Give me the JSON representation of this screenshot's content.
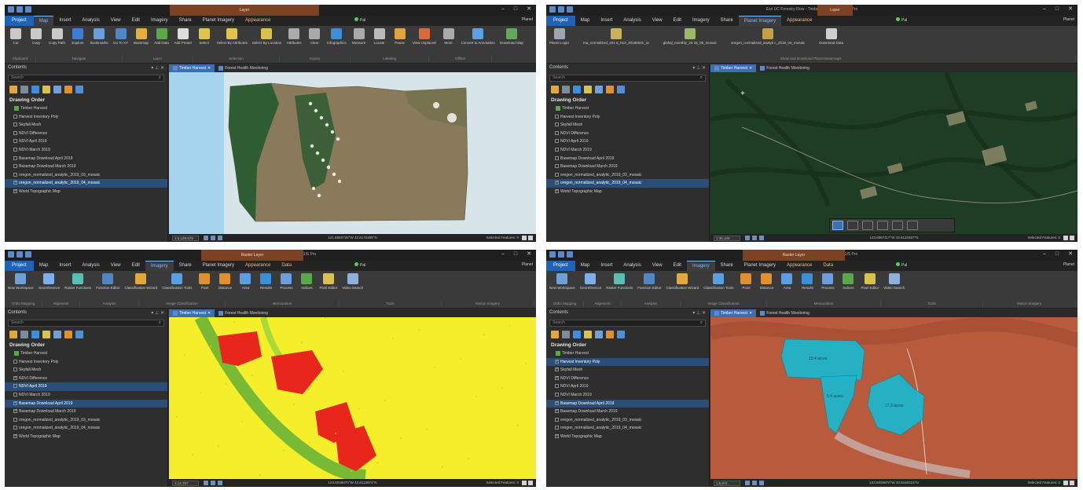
{
  "panels": [
    {
      "id": "p1",
      "window_title": "Esri UC Forestry Flow - Timber Harvest - ArcGIS Pro",
      "contextual_tab_group": "Layer",
      "tabs": [
        "Project",
        "Map",
        "Insert",
        "Analysis",
        "View",
        "Edit",
        "Imagery",
        "Share",
        "Planet Imagery",
        "Appearance"
      ],
      "active_tab": "Map",
      "user": "Pal",
      "user_right": "Planet",
      "ribbon_buttons": [
        "Cut",
        "Copy",
        "Copy Path",
        "Explore",
        "Bookmarks",
        "Go To XY",
        "Basemap",
        "Add Data",
        "Add Preset",
        "Select",
        "Select By Attributes",
        "Select By Location",
        "Attributes",
        "Clear",
        "Infographics",
        "Measure",
        "Locate",
        "Pause",
        "View Unplaced",
        "More",
        "Convert to Annotation",
        "Download Map"
      ],
      "ribbon_groups": [
        "Clipboard",
        "Navigate",
        "Layer",
        "Selection",
        "Inquiry",
        "Labeling",
        "Offline"
      ],
      "map_tabs": [
        "Timber Harvest",
        "Forest Health Monitoring"
      ],
      "scale": "1:6,129,879",
      "coordinates": "121.6865729°W 43.6172485°N",
      "selected_features": "Selected Features: 0"
    },
    {
      "id": "p2",
      "window_title": "Esri UC Forestry Flow - Timber Harvest - ArcGIS Pro",
      "contextual_tab_group": "Layer",
      "tabs": [
        "Project",
        "Map",
        "Insert",
        "Analysis",
        "View",
        "Edit",
        "Imagery",
        "Share",
        "Planet Imagery",
        "Appearance"
      ],
      "active_tab": "Planet Imagery",
      "user": "Pal",
      "user_right": "Planet",
      "ribbon_buttons": [
        "Planet Login",
        "ma_normalized_201 8_013_20180531_ra",
        "global_monthly_20 18_05_mosaic",
        "oregon_normalized_analyti c_2019_04_mosaic",
        "Download Data"
      ],
      "ribbon_groups": [
        "Show and Download Planet Basemaps"
      ],
      "map_tabs": [
        "Timber Harvest",
        "Forest Health Monitoring"
      ],
      "scale": "1:36,109",
      "coordinates": "123.8067117°W 43.6134467°N",
      "selected_features": "Selected Features: 0"
    },
    {
      "id": "p3",
      "window_title": "Esri UC Forestry Flow - Timber Harvest - ArcGIS Pro",
      "contextual_tab_group": "Raster Layer",
      "tabs": [
        "Project",
        "Map",
        "Insert",
        "Analysis",
        "View",
        "Edit",
        "Imagery",
        "Share",
        "Planet Imagery",
        "Appearance",
        "Data"
      ],
      "active_tab": "Imagery",
      "user": "Pal",
      "user_right": "Planet",
      "ribbon_buttons": [
        "New Workspace",
        "Georeference",
        "Raster Functions",
        "Function Editor",
        "Classification Wizard",
        "Classification Tools",
        "Pixel",
        "Distance",
        "Area",
        "Results",
        "Process",
        "Indices",
        "Pixel Editor",
        "Video Search"
      ],
      "ribbon_groups": [
        "Ortho Mapping",
        "Alignment",
        "Analysis",
        "Image Classification",
        "Mensuration",
        "Tools",
        "Motion Imagery"
      ],
      "map_tabs": [
        "Timber Harvest",
        "Forest Health Monitoring"
      ],
      "scale": "1:14,757",
      "coordinates": "123.6036870°W 43.6112974°N",
      "selected_features": "Selected Features: 0"
    },
    {
      "id": "p4",
      "window_title": "Esri UC Forestry Flow - Timber Harvest - ArcGIS Pro",
      "contextual_tab_group": "Raster Layer",
      "tabs": [
        "Project",
        "Map",
        "Insert",
        "Analysis",
        "View",
        "Edit",
        "Imagery",
        "Share",
        "Planet Imagery",
        "Appearance",
        "Data"
      ],
      "active_tab": "Imagery",
      "user": "Pal",
      "user_right": "Planet",
      "ribbon_buttons": [
        "New Workspace",
        "Georeference",
        "Raster Functions",
        "Function Editor",
        "Classification Wizard",
        "Classification Tools",
        "Point",
        "Distance",
        "Area",
        "Results",
        "Process",
        "Indices",
        "Pixel Editor",
        "Video Search"
      ],
      "ribbon_groups": [
        "Ortho Mapping",
        "Alignment",
        "Analysis",
        "Image Classification",
        "Mensuration",
        "Tools",
        "Motion Imagery"
      ],
      "map_tabs": [
        "Timber Harvest",
        "Forest Health Monitoring"
      ],
      "scale": "1:5,671",
      "coordinates": "123.6036870°W 43.6150313°N",
      "selected_features": "Selected Features: 0",
      "harvest_units": [
        "15.4 acres",
        "5.4 acres",
        "17.3 acres"
      ]
    }
  ],
  "contents": {
    "title": "Contents",
    "search_placeholder": "Search",
    "drawing_order": "Drawing Order",
    "map_name": "Timber Harvest",
    "layers": [
      "Harvest Inventory Poly",
      "Skyfall Mesh",
      "NDVI Difference",
      "NDVI April 2019",
      "NDVI March 2019",
      "Basemap Download April 2019",
      "Basemap Download March 2019",
      "oregon_normalized_analytic_2019_03_mosaic",
      "oregon_normalized_analytic_2019_04_mosaic",
      "World Topographic Map"
    ]
  },
  "panel_states": {
    "p1": {
      "checked": [
        false,
        false,
        false,
        false,
        false,
        false,
        false,
        false,
        true,
        true
      ],
      "selected": [
        8
      ]
    },
    "p2": {
      "checked": [
        false,
        false,
        false,
        false,
        false,
        false,
        false,
        false,
        true,
        true
      ],
      "selected": [
        8
      ]
    },
    "p3": {
      "checked": [
        false,
        false,
        true,
        false,
        false,
        true,
        true,
        false,
        false,
        true
      ],
      "selected": [
        3,
        5
      ]
    },
    "p4": {
      "checked": [
        true,
        true,
        true,
        false,
        false,
        true,
        true,
        false,
        false,
        true
      ],
      "selected": [
        0,
        5
      ]
    }
  },
  "colors": {
    "project_tab": "#1e63b5",
    "contextual_band": "#7b4324",
    "selection": "#2b4e79",
    "ndvi_loss": "#e8261c",
    "ndvi_stable": "#f4ef2a",
    "harvest_polygon": "#19b8cf"
  },
  "icons": [
    "map-icon",
    "layer-group-icon",
    "search-icon",
    "pin-icon",
    "close-icon",
    "minimize-icon",
    "maximize-icon"
  ]
}
